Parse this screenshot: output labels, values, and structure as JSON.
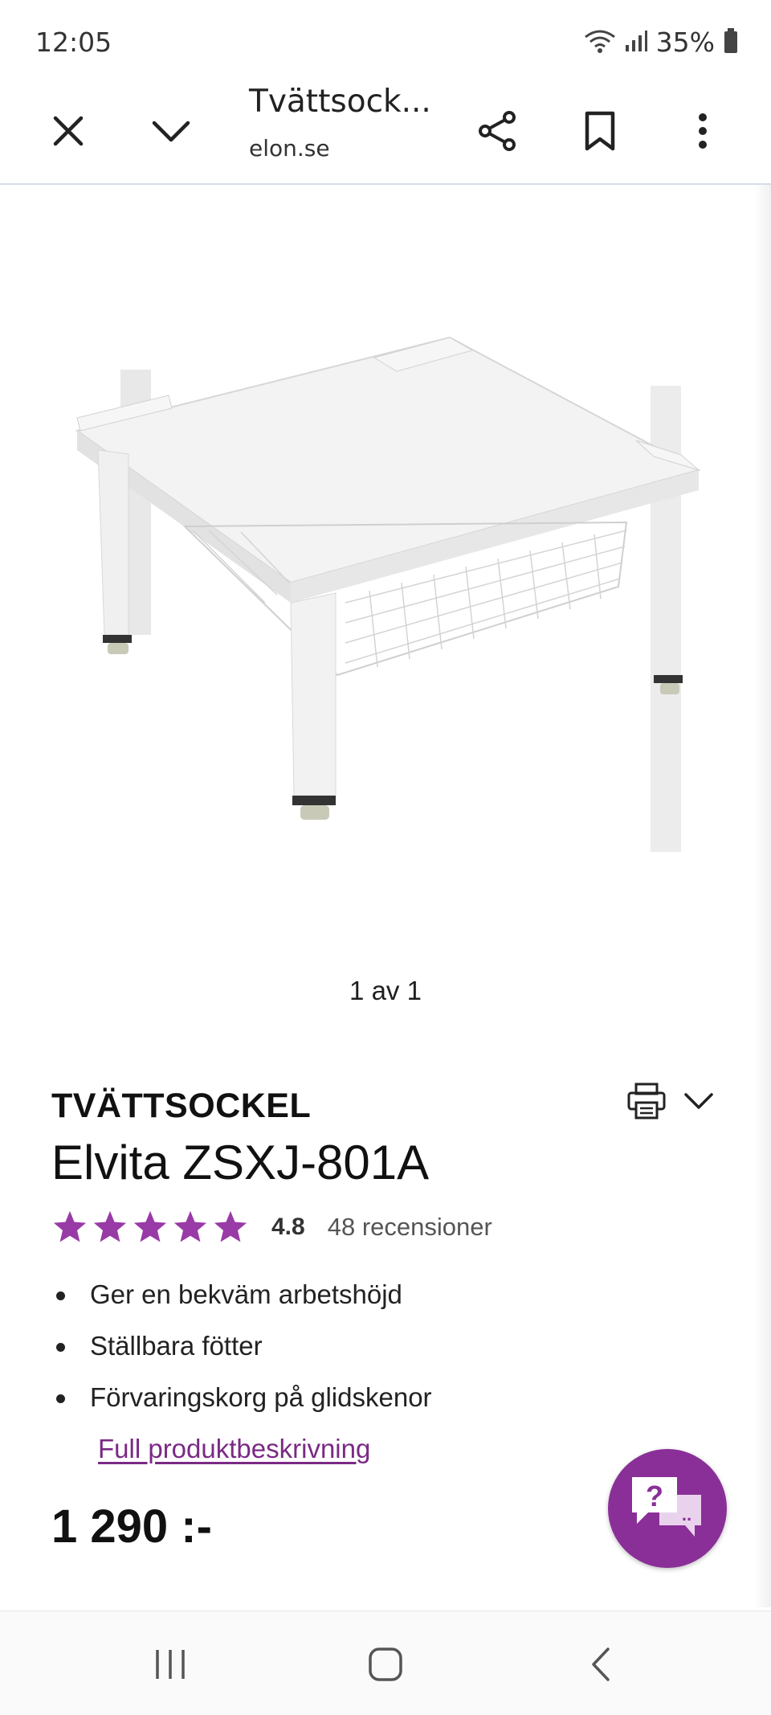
{
  "status_bar": {
    "time": "12:05",
    "battery_text": "35%"
  },
  "browser": {
    "title": "Tvättsock...",
    "domain": "elon.se"
  },
  "gallery": {
    "pager": "1 av 1"
  },
  "product": {
    "category": "TVÄTTSOCKEL",
    "name": "Elvita ZSXJ-801A",
    "rating": "4.8",
    "rating_value": 4.8,
    "rating_max": 5,
    "reviews": "48 recensioner",
    "bullets": [
      "Ger en bekväm arbetshöjd",
      "Ställbara fötter",
      "Förvaringskorg på glidskenor"
    ],
    "description_link": "Full produktbeskrivning",
    "price": "1 290 :-"
  },
  "chat": {
    "primary": "?",
    "secondary": ".."
  },
  "colors": {
    "accent": "#8a2f98",
    "star": "#993ba6",
    "link": "#7a2a84"
  },
  "icons": [
    "close-icon",
    "chevron-down-icon",
    "share-icon",
    "bookmark-icon",
    "more-vert-icon",
    "print-icon",
    "chat-icon",
    "recents-icon",
    "home-icon",
    "back-icon"
  ]
}
